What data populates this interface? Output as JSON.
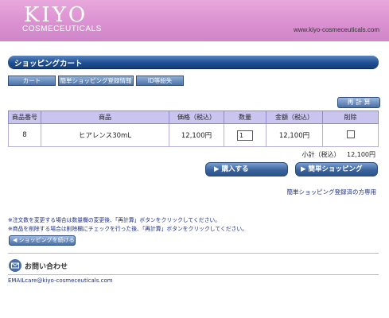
{
  "header": {
    "logo_main": "KIYO",
    "logo_sub": "COSMECEUTICALS",
    "url": "www.kiyo-cosmeceuticals.com"
  },
  "page_title": "ショッピングカート",
  "tabs": [
    "カート",
    "簡単ショッピング登録情報",
    "ID等紛失"
  ],
  "recalc_label": "再 計 算",
  "table": {
    "headers": [
      "商品番号",
      "商品",
      "価格（税込）",
      "数量",
      "金額（税込）",
      "削除"
    ],
    "rows": [
      {
        "id": "8",
        "name": "ヒアレンス30mL",
        "price": "12,100円",
        "qty": "1",
        "amount": "12,100円",
        "delete_checked": false
      }
    ]
  },
  "subtotal": {
    "label": "小計（税込）",
    "value": "12,100円"
  },
  "buttons": {
    "purchase": "▶ 購入する",
    "easy_shopping": "▶ 簡単ショッピング",
    "continue": "◀ ショッピングを続ける"
  },
  "easy_register_link": "簡単ショッピング登録済の方専用",
  "notes": [
    "※注文数を変更する場合は数量欄の変更後、「再計算」ボタンをクリックしてください。",
    "※商品を削除する場合は削除欄にチェックを行った後、「再計算」ボタンをクリックしてください。"
  ],
  "contact": {
    "title": "お問い合わせ",
    "email_label": "EMAIL",
    "email": "care@kiyo-cosmeceuticals.com"
  },
  "colors": {
    "header_pink": "#d98fd0",
    "bar_blue": "#1f4f94",
    "table_header": "#c9c5ef",
    "link_navy": "#1d2f86"
  }
}
